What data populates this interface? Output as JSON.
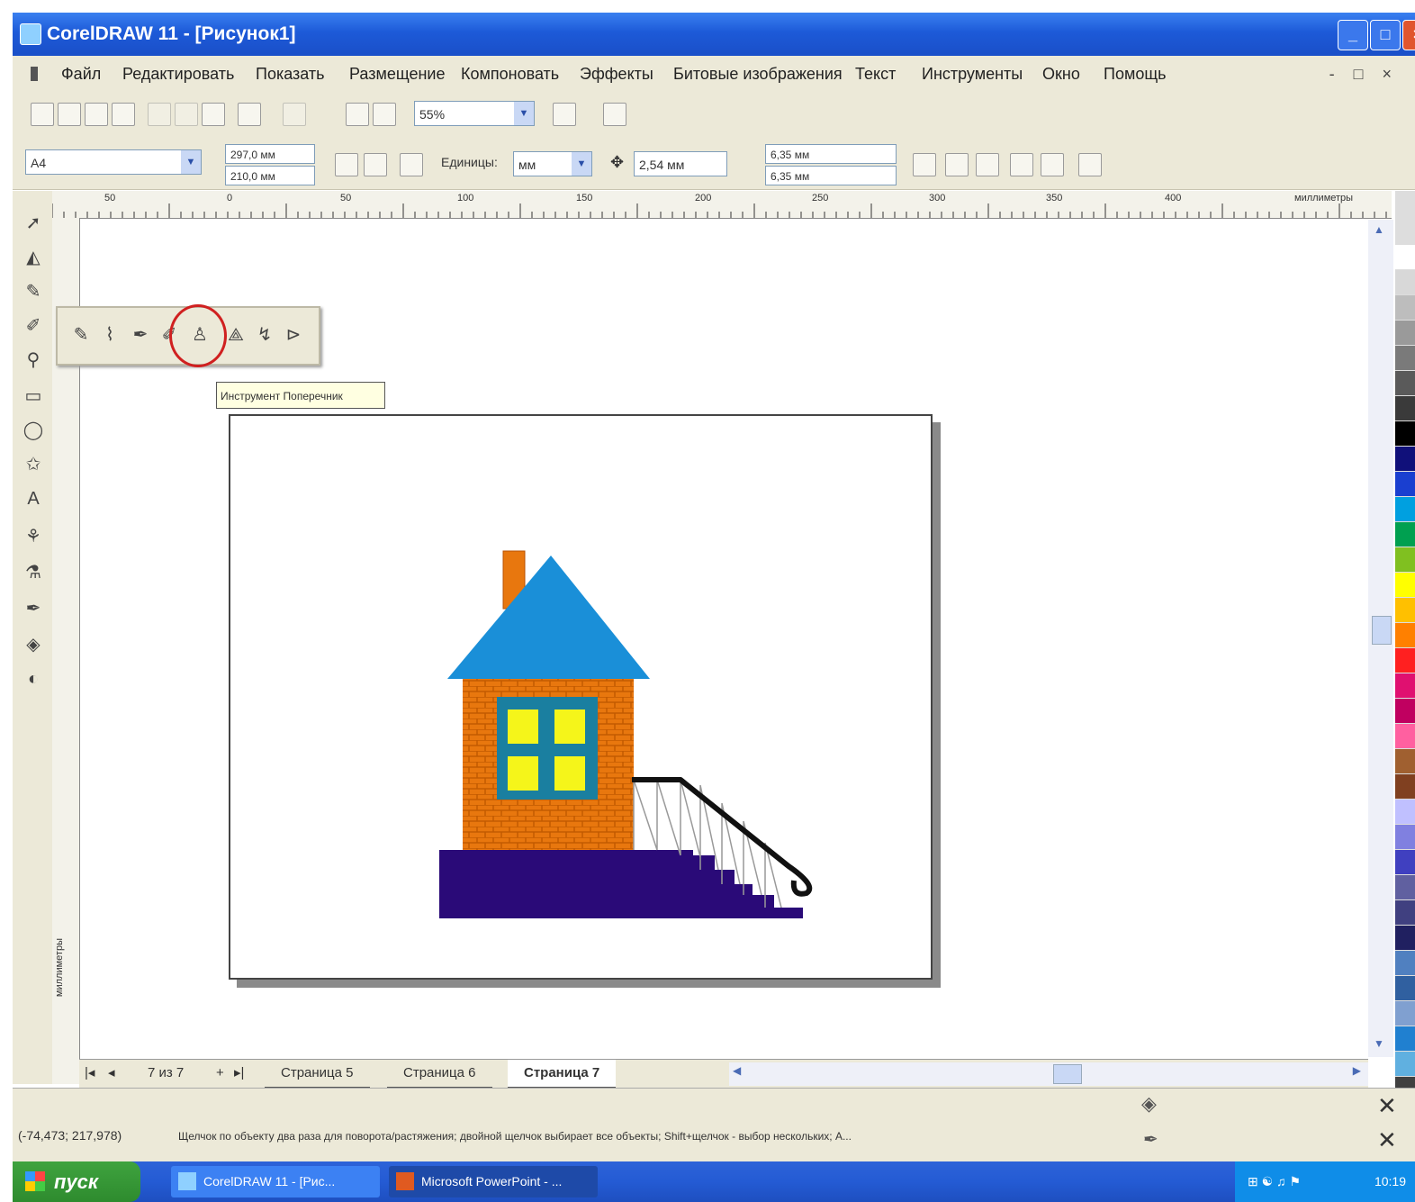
{
  "window": {
    "title": "CorelDRAW 11 - [Рисунок1]",
    "minimize_label": "_",
    "maximize_label": "□",
    "close_label": "×"
  },
  "menu": {
    "items": [
      "Файл",
      "Редактировать",
      "Показать",
      "Размещение",
      "Компоновать",
      "Эффекты",
      "Битовые изображения",
      "Текст",
      "Инструменты",
      "Окно",
      "Помощь"
    ],
    "mdi_controls": "- □ ×"
  },
  "toolbar1": {
    "zoom_value": "55%"
  },
  "toolbar2": {
    "paper_value": "A4",
    "width_value": "297,0 мм",
    "height_value": "210,0 мм",
    "units_label": "Единицы:",
    "units_value": "мм",
    "nudge_value": "2,54 мм",
    "dup_x": "6,35 мм",
    "dup_y": "6,35 мм"
  },
  "ruler": {
    "h_ticks": [
      "50",
      "0",
      "50",
      "100",
      "150",
      "200",
      "250",
      "300",
      "350",
      "400"
    ],
    "h_unit": "миллиметры",
    "v_unit": "миллиметры"
  },
  "flyout": {
    "tooltip": "Инструмент Поперечник"
  },
  "tabs": {
    "page_counter": "7 из 7",
    "pages": [
      "Страница 5",
      "Страница 6",
      "Страница 7"
    ],
    "active_index": 2
  },
  "status": {
    "coords": "(-74,473; 217,978)",
    "message": "Щелчок по объекту два раза для поворота/растяжения; двойной щелчок выбирает все объекты; Shift+щелчок - выбор нескольких; A..."
  },
  "taskbar": {
    "start_label": "пуск",
    "tasks": [
      "CorelDRAW 11 - [Рис...",
      "Microsoft PowerPoint - ..."
    ],
    "clock": "10:19"
  },
  "colors": {
    "titlebar": "#1d5ad8",
    "roof": "#1a8fd8",
    "brick": "#e8770e",
    "window_glass": "#f5f51a",
    "foundation": "#2a0a78",
    "chimney": "#e8770e"
  },
  "palette": [
    "#ffffff",
    "#d8d8d8",
    "#bdbdbd",
    "#9a9a9a",
    "#7a7a7a",
    "#5a5a5a",
    "#3a3a3a",
    "#000000",
    "#10107a",
    "#1a3fd0",
    "#00a0e0",
    "#00a050",
    "#80c020",
    "#ffff00",
    "#ffc000",
    "#ff8000",
    "#ff2020",
    "#e01070",
    "#c00060",
    "#ff60a0",
    "#a06030",
    "#804020",
    "#c0c0ff",
    "#8080e0",
    "#4040c0",
    "#6060a0",
    "#404080",
    "#202060",
    "#5080c0",
    "#3060a0",
    "#80a0d0",
    "#2080d0",
    "#60b0e0",
    "#404040",
    "#202020"
  ]
}
